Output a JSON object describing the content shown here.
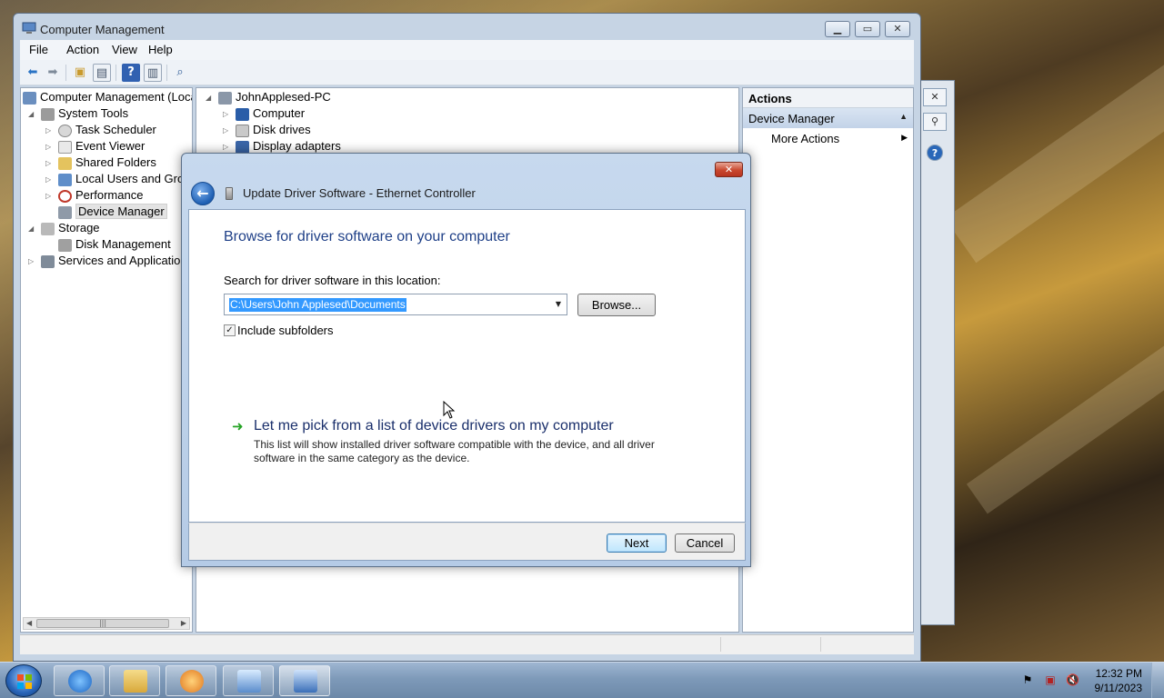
{
  "window": {
    "title": "Computer Management",
    "menu": [
      "File",
      "Action",
      "View",
      "Help"
    ]
  },
  "tree": {
    "items": [
      {
        "label": "Computer Management (Local",
        "expander": ""
      },
      {
        "label": "System Tools",
        "expander": "◢"
      },
      {
        "label": "Task Scheduler",
        "expander": "▷"
      },
      {
        "label": "Event Viewer",
        "expander": "▷"
      },
      {
        "label": "Shared Folders",
        "expander": "▷"
      },
      {
        "label": "Local Users and Group",
        "expander": "▷"
      },
      {
        "label": "Performance",
        "expander": "▷"
      },
      {
        "label": "Device Manager",
        "expander": ""
      },
      {
        "label": "Storage",
        "expander": "◢"
      },
      {
        "label": "Disk Management",
        "expander": ""
      },
      {
        "label": "Services and Applications",
        "expander": "▷"
      }
    ],
    "selected": "Device Manager"
  },
  "devices": {
    "root": "JohnApplesed-PC",
    "items": [
      "Computer",
      "Disk drives",
      "Display adapters"
    ]
  },
  "actions": {
    "header": "Actions",
    "section": "Device Manager",
    "more": "More Actions"
  },
  "dialog": {
    "title": "Update Driver Software - Ethernet Controller",
    "heading": "Browse for driver software on your computer",
    "search_label": "Search for driver software in this location:",
    "path_value": "C:\\Users\\John Applesed\\Documents",
    "browse_label": "Browse...",
    "include_subfolders_label": "Include subfolders",
    "include_subfolders_checked": true,
    "pick_link": "Let me pick from a list of device drivers on my computer",
    "pick_desc": "This list will show installed driver software compatible with the device, and all driver software in the same category as the device.",
    "next_label": "Next",
    "cancel_label": "Cancel"
  },
  "taskbar": {
    "time": "12:32 PM",
    "date": "9/11/2023"
  },
  "colors": {
    "heading_blue": "#1e3f87",
    "link_green_arrow": "#24a324",
    "selection_blue": "#3399ff"
  }
}
